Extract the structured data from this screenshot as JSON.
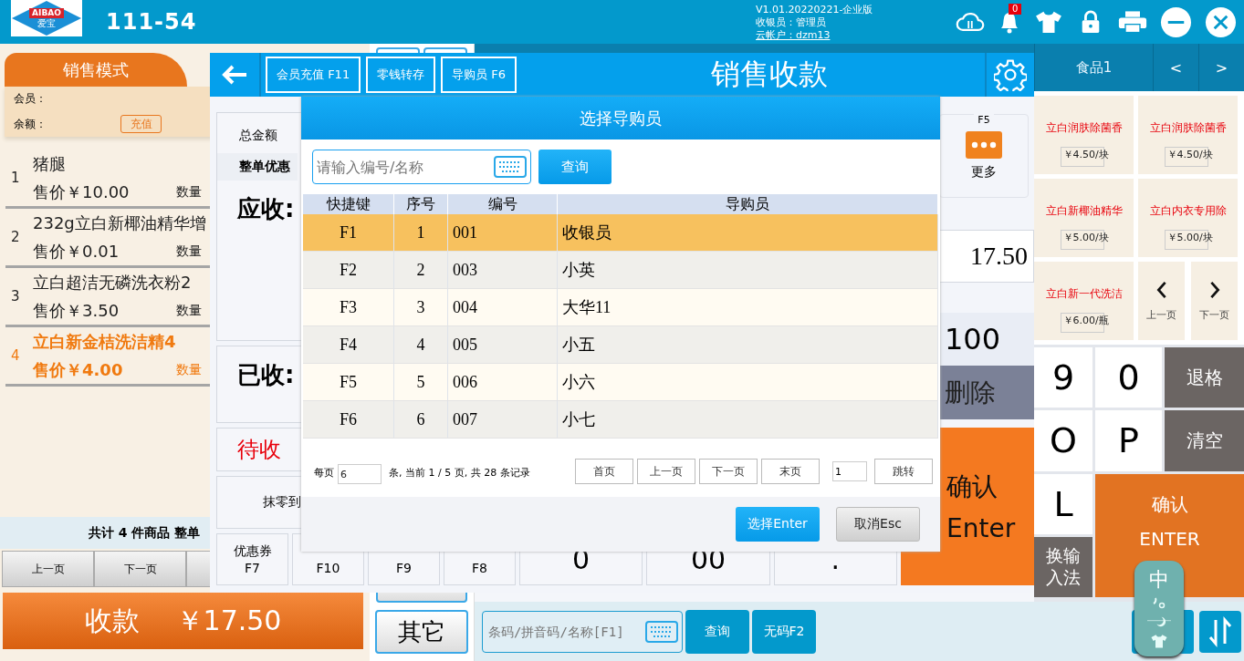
{
  "top_bar": {
    "logo_text": "AIBAO",
    "logo_subtext": "爱宝",
    "terminal": "111-54",
    "version": "V1.01.20220221-企业版",
    "cashier": "收银员：管理员",
    "cloud_account": "云帐户：dzm13",
    "notification_count": "0"
  },
  "sale_panel": {
    "mode_tab": "销售模式",
    "member_label": "会员：",
    "balance_label": "余额：",
    "recharge_button": "充值",
    "items": [
      {
        "index": "1",
        "name": "猪腿",
        "price": "售价￥10.00",
        "qty_label": "数量",
        "selected": false
      },
      {
        "index": "2",
        "name": "232g立白新椰油精华增",
        "price": "售价￥0.01",
        "qty_label": "数量",
        "selected": false
      },
      {
        "index": "3",
        "name": "立白超洁无磷洗衣粉2",
        "price": "售价￥3.50",
        "qty_label": "数量",
        "selected": false
      },
      {
        "index": "4",
        "name": "立白新金桔洗洁精4",
        "price": "售价￥4.00",
        "qty_label": "数量",
        "selected": true
      }
    ],
    "summary": "共计 4 件商品 整单",
    "pager": [
      "上一页",
      "下一页"
    ],
    "checkout": {
      "label": "收款",
      "amount": "￥17.50"
    }
  },
  "middle_column": {
    "other_button": "其它"
  },
  "category_bar": {
    "tabs": [
      {
        "label": "食品1",
        "selected": false
      }
    ],
    "prev": "<",
    "next": ">"
  },
  "products": [
    {
      "name": "立白润肤除菌香",
      "price": "￥4.50/块"
    },
    {
      "name": "立白润肤除菌香",
      "price": "￥4.50/块"
    },
    {
      "name": "立白新椰油精华",
      "price": "￥5.00/块"
    },
    {
      "name": "立白内衣专用除",
      "price": "￥5.00/块"
    },
    {
      "name": "立白新一代洗洁",
      "price": "￥6.00/瓶"
    }
  ],
  "product_pager": [
    {
      "kind": "prev",
      "label": "上一页"
    },
    {
      "kind": "next",
      "label": "下一页"
    }
  ],
  "keypad": [
    {
      "kind": "char",
      "label": "9"
    },
    {
      "kind": "char",
      "label": "0"
    },
    {
      "kind": "function",
      "label": "退格"
    },
    {
      "kind": "char",
      "label": "O"
    },
    {
      "kind": "char",
      "label": "P"
    },
    {
      "kind": "function",
      "label": "清空"
    },
    {
      "kind": "char",
      "label": "L"
    },
    {
      "kind": "enter",
      "label": "确认",
      "sublabel": "ENTER"
    },
    {
      "kind": "function",
      "label": "换输入法"
    }
  ],
  "bottom_bar": {
    "search": {
      "placeholder": "条码/拼音码/名称[F1]"
    },
    "buttons": [
      "查询",
      "无码F2"
    ]
  },
  "ime_widget": {
    "mode": "中"
  },
  "payment_dialog": {
    "title": "销售收款",
    "header_buttons": [
      "会员充值 F11",
      "零钱转存",
      "导购员 F6"
    ],
    "total_label": "总金额",
    "discount_label": "整单优惠",
    "due_label": "应收:",
    "received_label": "已收:",
    "pending_label": "待收",
    "rounding_label": "抹零到",
    "function_buttons": [
      {
        "label": "优惠券",
        "key": "F7"
      },
      {
        "key": "F10"
      },
      {
        "key": "F9"
      },
      {
        "key": "F8"
      }
    ],
    "more": {
      "key": "F5",
      "label": "更多"
    },
    "amount_due": "17.50",
    "received_amount": "100",
    "delete_button": "删除",
    "confirm": {
      "label": "确认",
      "key": "Enter"
    },
    "numpad": [
      "0",
      "00",
      "."
    ]
  },
  "guide_dialog": {
    "title": "选择导购员",
    "search": {
      "placeholder": "请输入编号/名称"
    },
    "search_button": "查询",
    "columns": [
      "快捷键",
      "序号",
      "编号",
      "导购员"
    ],
    "rows": [
      {
        "shortcut": "F1",
        "index": "1",
        "code": "001",
        "name": "收银员",
        "selected": true
      },
      {
        "shortcut": "F2",
        "index": "2",
        "code": "003",
        "name": "小英",
        "selected": false
      },
      {
        "shortcut": "F3",
        "index": "3",
        "code": "004",
        "name": "大华11",
        "selected": false
      },
      {
        "shortcut": "F4",
        "index": "4",
        "code": "005",
        "name": "小五",
        "selected": false
      },
      {
        "shortcut": "F5",
        "index": "5",
        "code": "006",
        "name": "小六",
        "selected": false
      },
      {
        "shortcut": "F6",
        "index": "6",
        "code": "007",
        "name": "小七",
        "selected": false
      }
    ],
    "pagination": {
      "per_page_label": "每页",
      "per_page": "6",
      "summary": "条, 当前 1 / 5 页, 共 28 条记录",
      "buttons": [
        "首页",
        "上一页",
        "下一页",
        "末页"
      ],
      "page": "1",
      "jump_button": "跳转"
    },
    "actions": [
      {
        "kind": "primary",
        "label": "选择Enter"
      },
      {
        "kind": "secondary",
        "label": "取消Esc"
      }
    ]
  }
}
